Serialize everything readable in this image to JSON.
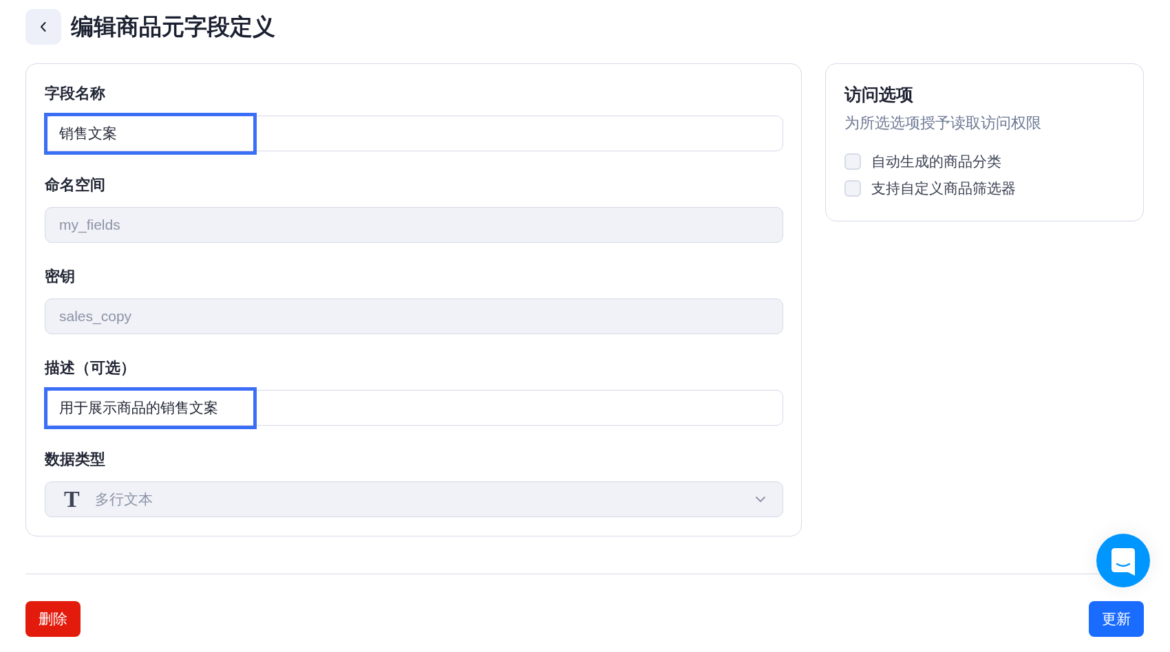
{
  "header": {
    "title": "编辑商品元字段定义"
  },
  "form": {
    "fields": [
      {
        "kind": "text",
        "label": "字段名称",
        "value": "销售文案",
        "disabled": false,
        "highlighted": true
      },
      {
        "kind": "text",
        "label": "命名空间",
        "value": "my_fields",
        "disabled": true,
        "highlighted": false
      },
      {
        "kind": "text",
        "label": "密钥",
        "value": "sales_copy",
        "disabled": true,
        "highlighted": false
      },
      {
        "kind": "text",
        "label": "描述（可选）",
        "value": "用于展示商品的销售文案",
        "disabled": false,
        "highlighted": true
      },
      {
        "kind": "select",
        "label": "数据类型",
        "icon_glyph": "T",
        "value": "多行文本",
        "disabled": true,
        "highlighted": false
      }
    ]
  },
  "access_panel": {
    "title": "访问选项",
    "subtitle": "为所选选项授予读取访问权限",
    "options": [
      {
        "label": "自动生成的商品分类",
        "checked": false
      },
      {
        "label": "支持自定义商品筛选器",
        "checked": false
      }
    ]
  },
  "actions": [
    {
      "kind": "danger",
      "label": "删除"
    },
    {
      "kind": "primary",
      "label": "更新"
    }
  ]
}
